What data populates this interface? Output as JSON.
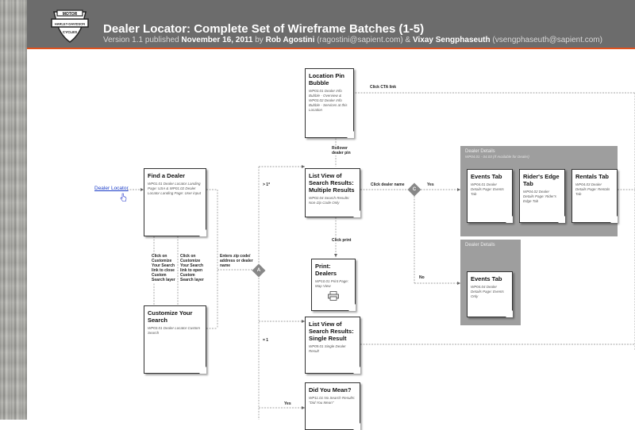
{
  "header": {
    "title": "Dealer Locator: Complete Set of Wireframe Batches (1-5)",
    "version_prefix": "Version 1.1 published",
    "date": "November 16, 2011",
    "by": "by",
    "author1": "Rob Agostini",
    "author1_email": "(ragostini@sapient.com)",
    "amp": "&",
    "author2": "Vixay Sengphaseuth",
    "author2_email": "(vsengphaseuth@sapient.com)",
    "logo_text_top": "MOTOR",
    "logo_text_mid": "HARLEY-DAVIDSON",
    "logo_text_bot": "CYCLES"
  },
  "start_link": "Dealer Locator",
  "boxes": {
    "find_dealer": {
      "title": "Find a Dealer",
      "desc": "WP01.01 Dealer Locator Landing Page: USA & WP01.02 Dealer Locator Landing Page: User input"
    },
    "customize": {
      "title": "Customize Your Search",
      "desc": "WP03.01 Dealer Locator Custom Search"
    },
    "pin_bubble": {
      "title": "Location Pin Bubble",
      "desc": "WP03.01 Dealer Info Bubble - Overview & WP03.02 Dealer Info Bubble - Services at this Location"
    },
    "list_multi": {
      "title": "List View of Search Results: Multiple Results",
      "desc": "WP02.04 Search Results: Non-Zip Code Only"
    },
    "print": {
      "title": "Print: Dealers",
      "desc": "WP10.01 Print Page: Map View"
    },
    "list_single": {
      "title": "List View of Search Results: Single Result",
      "desc": "WP09.01 Single Dealer Result"
    },
    "did_you_mean": {
      "title": "Did You Mean?",
      "desc": "WP11.01 No Search Results: \"Did You Mean\""
    },
    "events_tab_1": {
      "title": "Events Tab",
      "desc": "WP04.01 Dealer Details Page: Events Tab"
    },
    "riders_edge": {
      "title": "Rider's Edge Tab",
      "desc": "WP04.02 Dealer Details Page: Rider's Edge Tab"
    },
    "rentals": {
      "title": "Rentals Tab",
      "desc": "WP04.03 Dealer Details Page: Rentals Tab"
    },
    "events_tab_2": {
      "title": "Events Tab",
      "desc": "WP04.04 Dealer Details Page: Events Only"
    }
  },
  "groups": {
    "details_full": {
      "title": "Dealer Details",
      "desc": "WP04.01 - 04.03 (If Available for Dealer)"
    },
    "details_events": {
      "title": "Dealer Details",
      "desc": ""
    }
  },
  "labels": {
    "click_cta": "Click CTA link",
    "rollover": "Rollover dealer pin",
    "gt1": "> 1*",
    "click_dealer": "Click dealer name",
    "yes1": "Yes",
    "no1": "No",
    "click_print": "Click print",
    "close_custom": "Click on Customize Your Search link to close Custom Search layer",
    "open_custom": "Click on Customize Your Search link to open Custom Search layer",
    "enter_zip": "Enters zip code/ address or dealer name",
    "eq1": "= 1",
    "yes2": "Yes",
    "diamond_a": "A",
    "diamond_c": "C"
  }
}
